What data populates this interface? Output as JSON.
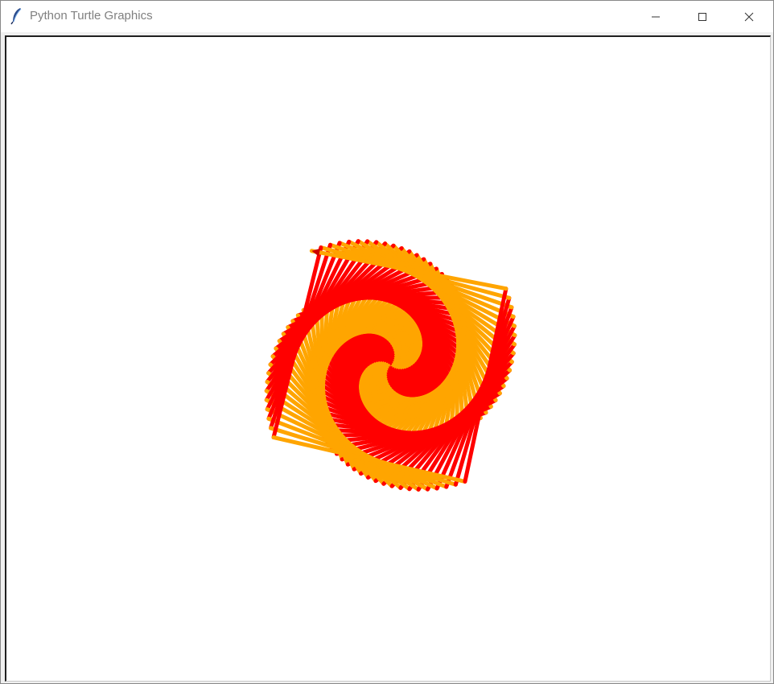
{
  "window": {
    "title": "Python Turtle Graphics",
    "icon": "feather-icon",
    "controls": {
      "minimize_icon": "minimize-icon",
      "maximize_icon": "maximize-icon",
      "close_icon": "close-icon"
    }
  },
  "canvas": {
    "background": "#ffffff",
    "drawing": {
      "description_type": "turtle spiral of squares",
      "pen_colors": [
        "#ff0000",
        "#ffa500"
      ],
      "shape": "square-spiral",
      "turn_angle_degrees": 91,
      "color_alternation": "alternating red and orange",
      "cursor_icon": "turtle-arrow-icon"
    }
  }
}
